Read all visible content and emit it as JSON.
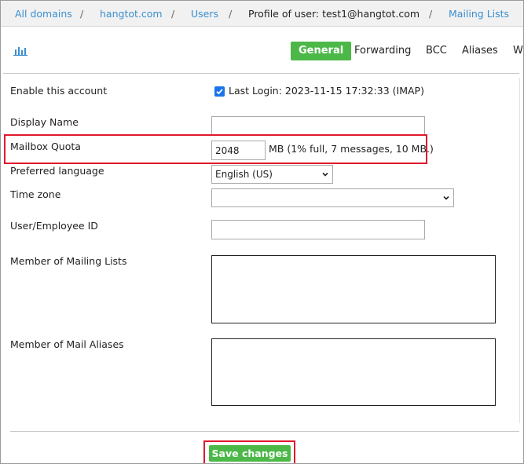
{
  "breadcrumb": {
    "items": [
      "All domains",
      "hangtot.com",
      "Users"
    ],
    "current": "Profile of user: test1@hangtot.com",
    "last": "Mailing Lists",
    "separator": "/"
  },
  "tabs": {
    "stats_icon": "bar-chart-icon",
    "items": [
      "General",
      "Forwarding",
      "BCC",
      "Aliases",
      "Wh"
    ],
    "active": "General"
  },
  "form": {
    "enable_account": {
      "label": "Enable this account",
      "checked": true,
      "last_login": "Last Login: 2023-11-15 17:32:33 (IMAP)"
    },
    "display_name": {
      "label": "Display Name",
      "value": ""
    },
    "mailbox_quota": {
      "label": "Mailbox Quota",
      "value": "2048",
      "unit_info": "MB (1% full, 7 messages, 10 MB.)"
    },
    "preferred_language": {
      "label": "Preferred language",
      "value": "English (US)"
    },
    "time_zone": {
      "label": "Time zone",
      "value": ""
    },
    "employee_id": {
      "label": "User/Employee ID",
      "value": ""
    },
    "mailing_lists": {
      "label": "Member of Mailing Lists"
    },
    "mail_aliases": {
      "label": "Member of Mail Aliases"
    }
  },
  "actions": {
    "save_label": "Save changes"
  },
  "colors": {
    "accent_green": "#4cb848",
    "link_blue": "#3a8fd0",
    "highlight_red": "#e0182d",
    "checkbox_blue": "#1a73e8"
  }
}
